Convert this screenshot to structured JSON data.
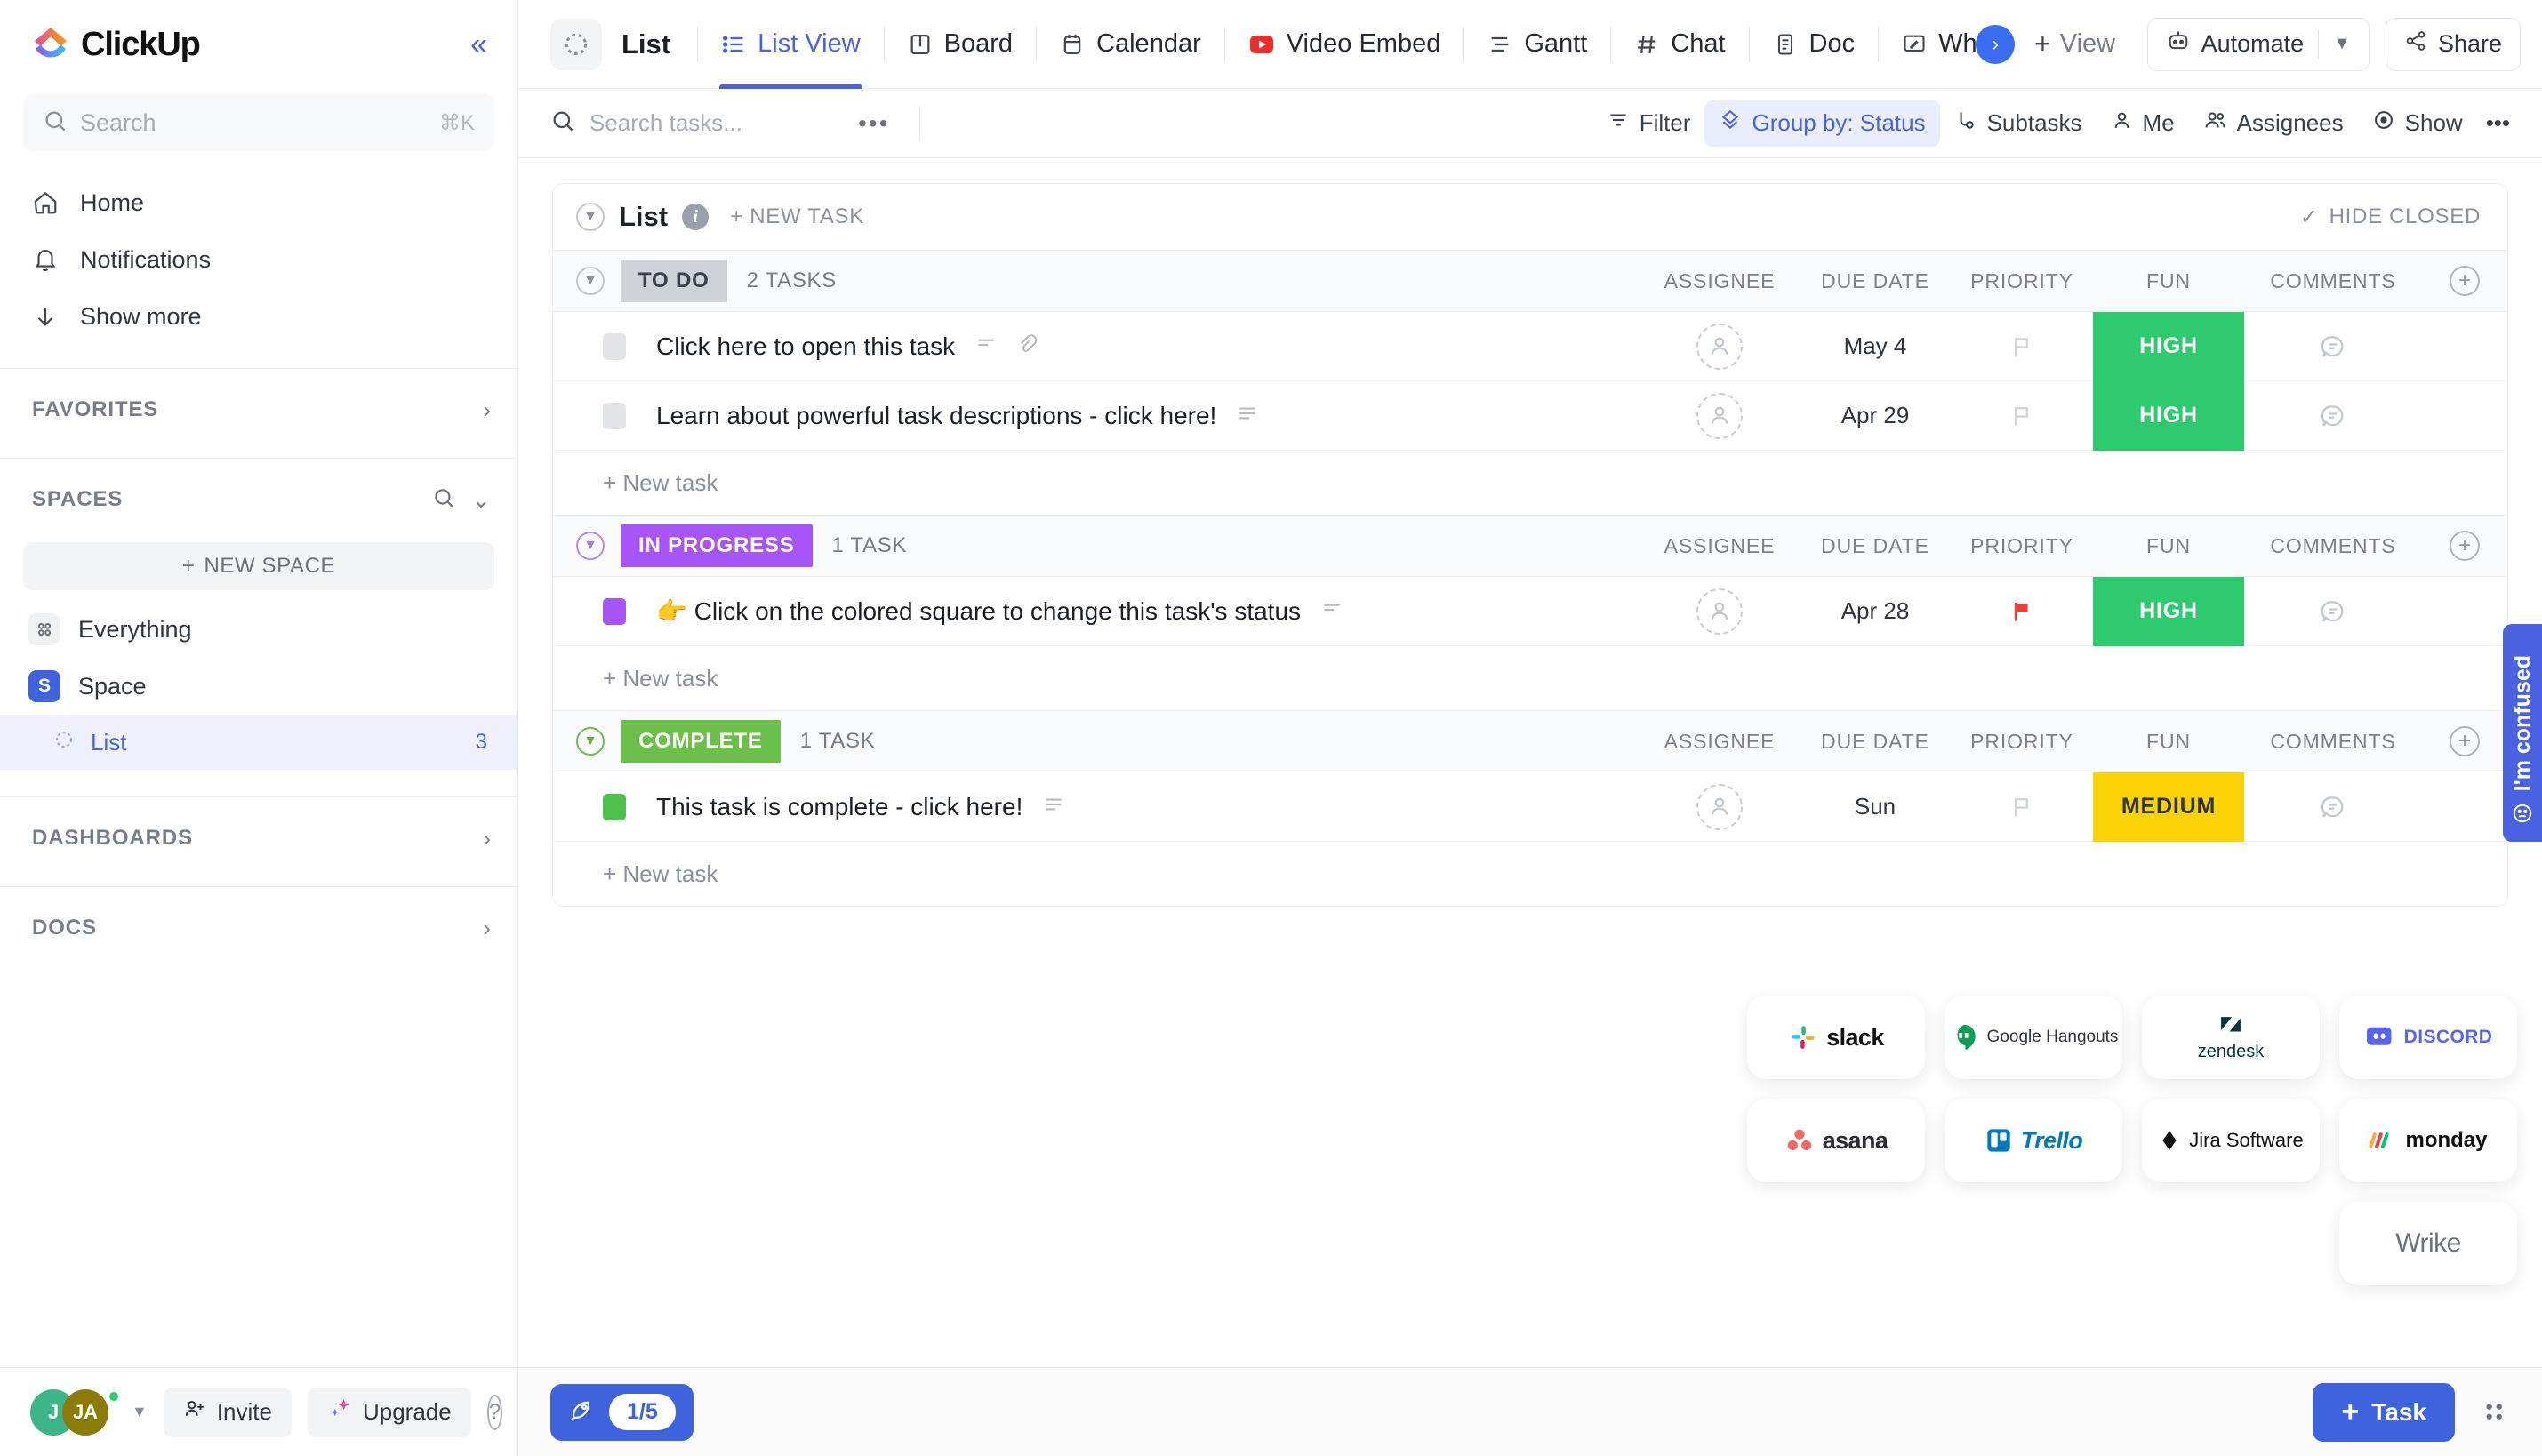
{
  "brand": {
    "name": "ClickUp",
    "accent": "#4a61e0",
    "blue": "#3e63dd"
  },
  "sidebar": {
    "collapse_icon": "chevrons-left-icon",
    "search": {
      "placeholder": "Search",
      "shortcut": "⌘K"
    },
    "nav": [
      {
        "label": "Home",
        "icon": "home-icon"
      },
      {
        "label": "Notifications",
        "icon": "bell-icon"
      },
      {
        "label": "Show more",
        "icon": "arrow-down-icon"
      }
    ],
    "sections": {
      "favorites": "FAVORITES",
      "spaces": "SPACES",
      "dashboards": "DASHBOARDS",
      "docs": "DOCS"
    },
    "new_space": "NEW SPACE",
    "spaces_items": [
      {
        "label": "Everything",
        "glyph": "",
        "type": "everything"
      },
      {
        "label": "Space",
        "glyph": "S",
        "color": "#3e63dd",
        "type": "space"
      }
    ],
    "list_item": {
      "label": "List",
      "count": "3"
    },
    "bottom": {
      "avatar1": "J",
      "avatar2": "JA",
      "avatar1_color": "#3eb489",
      "avatar2_color": "#8a7c06",
      "invite": "Invite",
      "upgrade": "Upgrade",
      "help": "?"
    }
  },
  "topbar": {
    "list_name": "List",
    "tabs": [
      {
        "label": "List View",
        "icon": "list-view-icon",
        "active": true
      },
      {
        "label": "Board",
        "icon": "board-icon",
        "active": false
      },
      {
        "label": "Calendar",
        "icon": "calendar-icon",
        "active": false
      },
      {
        "label": "Video Embed",
        "icon": "youtube-icon",
        "active": false
      },
      {
        "label": "Gantt",
        "icon": "gantt-icon",
        "active": false
      },
      {
        "label": "Chat",
        "icon": "hash-icon",
        "active": false
      },
      {
        "label": "Doc",
        "icon": "doc-icon",
        "active": false
      },
      {
        "label": "Whi",
        "icon": "whiteboard-icon",
        "active": false
      }
    ],
    "add_view": "View",
    "automate": "Automate",
    "share": "Share"
  },
  "toolbar": {
    "search_placeholder": "Search tasks...",
    "buttons": [
      {
        "label": "Filter",
        "icon": "filter-icon",
        "active": false
      },
      {
        "label": "Group by: Status",
        "icon": "group-icon",
        "active": true
      },
      {
        "label": "Subtasks",
        "icon": "subtask-icon",
        "active": false
      },
      {
        "label": "Me",
        "icon": "person-icon",
        "active": false
      },
      {
        "label": "Assignees",
        "icon": "people-icon",
        "active": false
      },
      {
        "label": "Show",
        "icon": "eye-icon",
        "active": false
      }
    ],
    "more": "•••"
  },
  "list_card": {
    "title": "List",
    "new_task": "+ NEW TASK",
    "hide_closed": "HIDE CLOSED",
    "columns": [
      "ASSIGNEE",
      "DUE DATE",
      "PRIORITY",
      "FUN",
      "COMMENTS"
    ],
    "groups": [
      {
        "status": "TO DO",
        "status_bg": "#cfd2d6",
        "status_fg": "#3a404a",
        "count": "2 TASKS",
        "chev_color": "grey",
        "tasks": [
          {
            "name": "Click here to open this task",
            "check_color": "grey",
            "due": "May 4",
            "priority": "none",
            "fun": "HIGH",
            "fun_bg": "#2ecb6e",
            "fun_fg": "#ffffff",
            "has_description": true,
            "has_attachment": true
          },
          {
            "name": "Learn about powerful task descriptions - click here!",
            "check_color": "grey",
            "due": "Apr 29",
            "priority": "none",
            "fun": "HIGH",
            "fun_bg": "#2ecb6e",
            "fun_fg": "#ffffff",
            "has_description": true,
            "has_attachment": false
          }
        ],
        "new_task_label": "+ New task"
      },
      {
        "status": "IN PROGRESS",
        "status_bg": "#a855f7",
        "status_fg": "#ffffff",
        "count": "1 TASK",
        "chev_color": "purple",
        "tasks": [
          {
            "name": "👉 Click on the colored square to change this task's status",
            "check_color": "purple",
            "due": "Apr 28",
            "priority": "high-flag",
            "fun": "HIGH",
            "fun_bg": "#2ecb6e",
            "fun_fg": "#ffffff",
            "has_description": true,
            "has_attachment": false
          }
        ],
        "new_task_label": "+ New task"
      },
      {
        "status": "COMPLETE",
        "status_bg": "#6bbf4a",
        "status_fg": "#ffffff",
        "count": "1 TASK",
        "chev_color": "green",
        "tasks": [
          {
            "name": "This task is complete - click here!",
            "check_color": "green",
            "due": "Sun",
            "priority": "none",
            "fun": "MEDIUM",
            "fun_bg": "#fbd304",
            "fun_fg": "#2f3540",
            "has_description": true,
            "has_attachment": false
          }
        ],
        "new_task_label": "+ New task"
      }
    ]
  },
  "integrations": [
    {
      "name": "slack",
      "label": "slack"
    },
    {
      "name": "google-hangouts",
      "label": "Google Hangouts"
    },
    {
      "name": "zendesk",
      "label": "zendesk"
    },
    {
      "name": "discord",
      "label": "DISCORD"
    },
    {
      "name": "asana",
      "label": "asana"
    },
    {
      "name": "trello",
      "label": "Trello"
    },
    {
      "name": "jira-software",
      "label": "Jira Software"
    },
    {
      "name": "monday",
      "label": "monday"
    },
    {
      "name": "wrike",
      "label": "Wrike"
    }
  ],
  "confused_tab": {
    "label": "I'm confused"
  },
  "main_bottom": {
    "rocket_progress": "1/5",
    "task_button": "Task"
  }
}
